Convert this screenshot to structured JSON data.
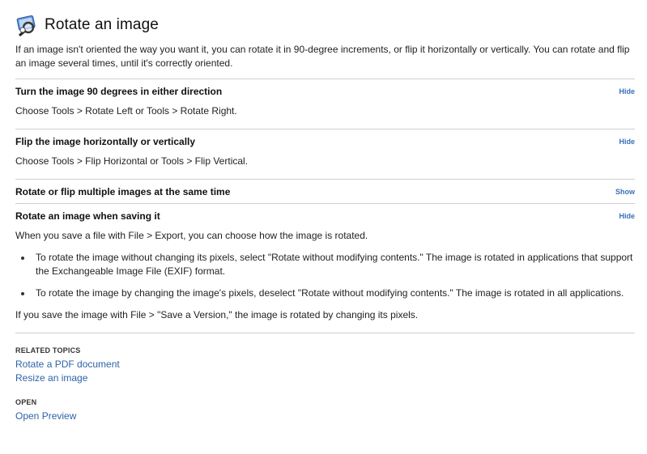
{
  "header": {
    "icon": "preview-app-icon",
    "title": "Rotate an image"
  },
  "intro": "If an image isn't oriented the way you want it, you can rotate it in 90-degree increments, or flip it horizontally or vertically. You can rotate and flip an image several times, until it's correctly oriented.",
  "sections": [
    {
      "title": "Turn the image 90 degrees in either direction",
      "toggle": "Hide",
      "body": "Choose Tools > Rotate Left or Tools > Rotate Right."
    },
    {
      "title": "Flip the image horizontally or vertically",
      "toggle": "Hide",
      "body": "Choose Tools > Flip Horizontal or Tools > Flip Vertical."
    },
    {
      "title": "Rotate or flip multiple images at the same time",
      "toggle": "Show"
    },
    {
      "title": "Rotate an image when saving it",
      "toggle": "Hide",
      "body": "When you save a file with File > Export, you can choose how the image is rotated.",
      "bullets": [
        "To rotate the image without changing its pixels, select \"Rotate without modifying contents.\" The image is rotated in applications that support the Exchangeable Image File (EXIF) format.",
        "To rotate the image by changing the image's pixels, deselect \"Rotate without modifying contents.\" The image is rotated in all applications."
      ],
      "after": "If you save the image with File > \"Save a Version,\" the image is rotated by changing its pixels."
    }
  ],
  "related": {
    "label": "RELATED TOPICS",
    "links": [
      "Rotate a PDF document",
      "Resize an image"
    ]
  },
  "open": {
    "label": "OPEN",
    "links": [
      "Open Preview"
    ]
  }
}
